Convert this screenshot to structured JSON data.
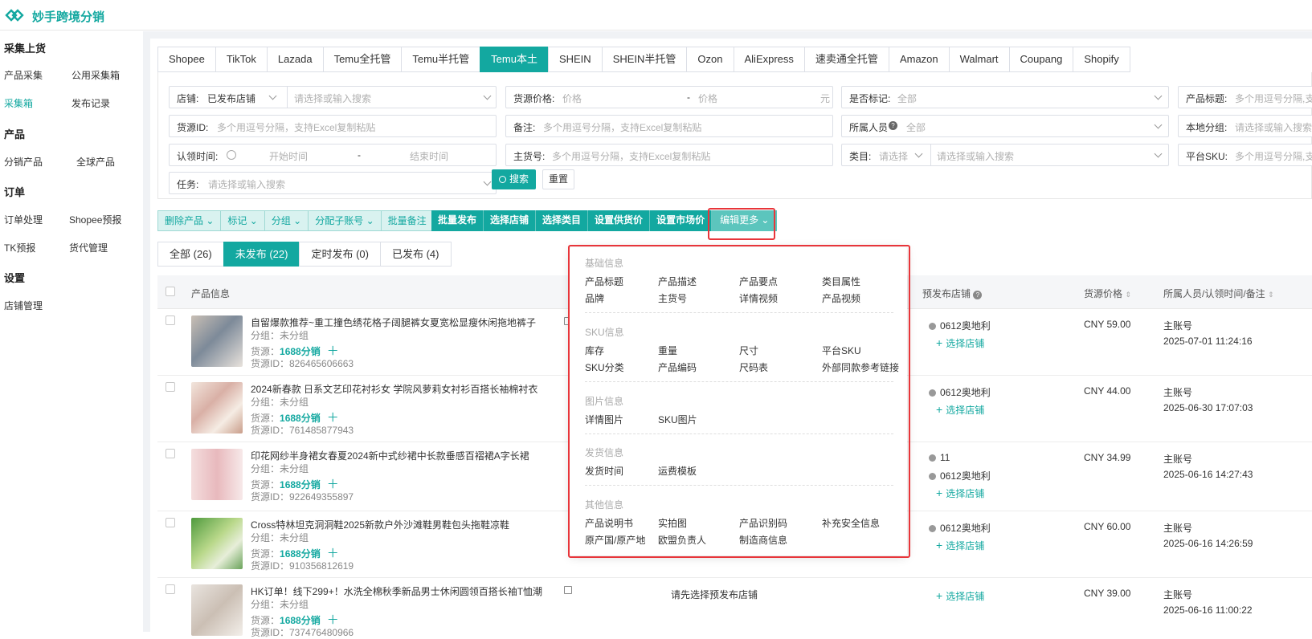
{
  "app": {
    "title": "妙手跨境分销"
  },
  "sidebar": {
    "sections": [
      {
        "title": "采集上货",
        "items": [
          "产品采集",
          "公用采集箱",
          "采集箱",
          "发布记录"
        ]
      },
      {
        "title": "产品",
        "items": [
          "分销产品",
          "全球产品"
        ]
      },
      {
        "title": "订单",
        "items": [
          "订单处理",
          "Shopee预报",
          "TK预报",
          "货代管理"
        ]
      },
      {
        "title": "设置",
        "items": [
          "店铺管理"
        ]
      }
    ],
    "active_item": "采集箱"
  },
  "platform_tabs": [
    "Shopee",
    "TikTok",
    "Lazada",
    "Temu全托管",
    "Temu半托管",
    "Temu本土",
    "SHEIN",
    "SHEIN半托管",
    "Ozon",
    "AliExpress",
    "速卖通全托管",
    "Amazon",
    "Walmart",
    "Coupang",
    "Shopify"
  ],
  "active_platform": "Temu本土",
  "filters": {
    "store_label": "店铺:",
    "store_value": "已发布店铺",
    "store_search_ph": "请选择或输入搜索",
    "price_label": "货源价格:",
    "price_min_ph": "价格",
    "price_dash": "-",
    "price_max_ph": "价格",
    "price_unit": "元",
    "marked_label": "是否标记:",
    "marked_value": "全部",
    "title_label": "产品标题:",
    "title_ph": "多个用逗号分隔,支",
    "source_id_label": "货源ID:",
    "source_id_ph": "多个用逗号分隔，支持Excel复制粘贴",
    "note_label": "备注:",
    "note_ph": "多个用逗号分隔，支持Excel复制粘贴",
    "owner_label": "所属人员",
    "owner_value": "全部",
    "local_group_label": "本地分组:",
    "local_group_ph": "请选择或输入搜索",
    "claim_time_label": "认领时间:",
    "claim_start_ph": "开始时间",
    "claim_dash": "-",
    "claim_end_ph": "结束时间",
    "main_sku_label": "主货号:",
    "main_sku_ph": "多个用逗号分隔，支持Excel复制粘贴",
    "category_label": "类目:",
    "category_select_ph": "请选择",
    "category_search_ph": "请选择或输入搜索",
    "platform_sku_label": "平台SKU:",
    "platform_sku_ph": "多个用逗号分隔,支",
    "task_label": "任务:",
    "task_ph": "请选择或输入搜索",
    "search_btn": "搜索",
    "reset_btn": "重置"
  },
  "actions_light": [
    "删除产品",
    "标记",
    "分组",
    "分配子账号",
    "批量备注"
  ],
  "actions_dark": [
    "批量发布",
    "选择店铺",
    "选择类目",
    "设置供货价",
    "设置市场价"
  ],
  "action_more": "编辑更多",
  "status_tabs": [
    "全部 (26)",
    "未发布 (22)",
    "定时发布 (0)",
    "已发布 (4)"
  ],
  "active_status": "未发布 (22)",
  "table_headers": {
    "product": "产品信息",
    "store": "预发布店铺",
    "price": "货源价格",
    "owner": "所属人员/认领时间/备注"
  },
  "products": [
    {
      "title": "自留爆款推荐~重工撞色绣花格子阔腿裤女夏宽松显瘦休闲拖地裤子",
      "group": "分组：未分组",
      "source_label": "货源：",
      "source": "1688分销",
      "source_id": "货源ID：826465606663",
      "stores": [
        "0612奥地利"
      ],
      "pick": "选择店铺",
      "price": "CNY 59.00",
      "owner": "主账号",
      "time": "2025-07-01 11:24:16"
    },
    {
      "title": "2024新春款 日系文艺印花衬衫女 学院风萝莉女衬衫百搭长袖棉衬衣",
      "group": "分组：未分组",
      "source_label": "货源：",
      "source": "1688分销",
      "source_id": "货源ID：761485877943",
      "stores": [
        "0612奥地利"
      ],
      "pick": "选择店铺",
      "price": "CNY 44.00",
      "owner": "主账号",
      "time": "2025-06-30 17:07:03"
    },
    {
      "title": "印花网纱半身裙女春夏2024新中式纱裙中长款垂感百褶裙A字长裙",
      "group": "分组：未分组",
      "source_label": "货源：",
      "source": "1688分销",
      "source_id": "货源ID：922649355897",
      "stores": [
        "11",
        "0612奥地利"
      ],
      "pick": "选择店铺",
      "price": "CNY 34.99",
      "owner": "主账号",
      "time": "2025-06-16 14:27:43"
    },
    {
      "title": "Cross特林坦克洞洞鞋2025新款户外沙滩鞋男鞋包头拖鞋凉鞋",
      "group": "分组：未分组",
      "source_label": "货源：",
      "source": "1688分销",
      "source_id": "货源ID：910356812619",
      "stores": [
        "0612奥地利"
      ],
      "pick": "选择店铺",
      "price": "CNY 60.00",
      "owner": "主账号",
      "time": "2025-06-16 14:26:59"
    },
    {
      "title": "HK订单！线下299+！水洗全棉秋季新品男士休闲圆领百搭长袖T恤潮",
      "group": "分组：未分组",
      "source_label": "货源：",
      "source": "1688分销",
      "source_id": "货源ID：737476480966",
      "stores": [],
      "store_hint": "请先选择预发布店铺",
      "pick": "选择店铺",
      "price": "CNY 39.00",
      "owner": "主账号",
      "time": "2025-06-16 11:00:22"
    }
  ],
  "dropdown": {
    "sections": [
      {
        "title": "基础信息",
        "items": [
          "产品标题",
          "产品描述",
          "产品要点",
          "类目属性",
          "品牌",
          "主货号",
          "详情视频",
          "产品视频"
        ]
      },
      {
        "title": "SKU信息",
        "items": [
          "库存",
          "重量",
          "尺寸",
          "平台SKU",
          "SKU分类",
          "产品编码",
          "尺码表",
          "外部同款参考链接"
        ]
      },
      {
        "title": "图片信息",
        "items": [
          "详情图片",
          "SKU图片"
        ]
      },
      {
        "title": "发货信息",
        "items": [
          "发货时间",
          "运费模板"
        ]
      },
      {
        "title": "其他信息",
        "items": [
          "产品说明书",
          "实拍图",
          "产品识别码",
          "补充安全信息",
          "原产国/原产地",
          "欧盟负责人",
          "制造商信息"
        ]
      }
    ]
  },
  "colors": {
    "accent": "#13a8a0",
    "highlight": "#e8353a"
  },
  "icons": {
    "logo": "logo-icon",
    "search": "search-icon",
    "clock": "clock-icon",
    "help": "help-icon",
    "sort": "sort-icon",
    "edit": "edit-icon"
  }
}
